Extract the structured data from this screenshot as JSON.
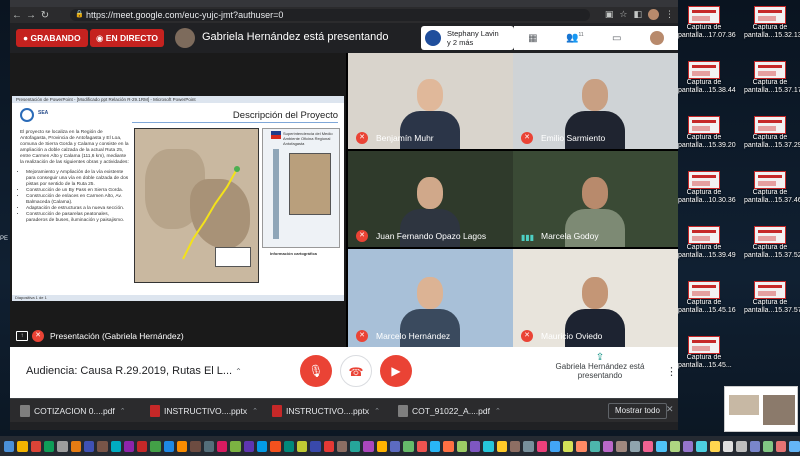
{
  "browser": {
    "url": "https://meet.google.com/euc-yujc-jmt?authuser=0"
  },
  "meet_header": {
    "recording_label": "GRABANDO",
    "live_label": "EN DIRECTO",
    "presenting_title": "Gabriela Hernández está presentando",
    "notif_line1": "Stephany Lavin",
    "notif_line2": "y 2 más",
    "people_count": "11",
    "you_label": "Tú"
  },
  "presentation": {
    "tile_label": "Presentación (Gabriela Hernández)",
    "window_title": "Presentación de PowerPoint - [Modificado ppt Relación R-29.1RM] - Microsoft PowerPoint",
    "slide_heading": "Descripción del Proyecto",
    "slide_logo": "SEA",
    "slide_intro": "El proyecto se localiza en la Región de Antofagasta, Provincia de Antofagasta y El Loa, comuna de Sierra Gorda y Calama y consiste en la ampliación a doble calzada de la actual Ruta 25, entre Carmen Alto y Calama (111,6 km), mediante la realización de las siguientes obras y actividades:",
    "bullets": [
      "Mejoramiento y Ampliación de la vía existente para conseguir una vía en doble calzada de dos pistas por sentido de la Ruta 25.",
      "Construcción de un By Pass en Sierra Gorda.",
      "Construcción de enlaces en Carmen Alto, Av. Balmaceda (Calama).",
      "Adaptación de estructuras a la nueva sección.",
      "Construcción de pasarelas peatonales, paraderos de buses, iluminación y paisajismo."
    ],
    "map_panel_header": "Superintendencia del Medio Ambiente Oficina Regional Antofagasta",
    "info_title": "Información cartográfica",
    "status_bar": "Diapositiva 1 de 1"
  },
  "participants": [
    {
      "name": "Benjamín Muhr",
      "muted": true
    },
    {
      "name": "Emilio Sarmiento",
      "muted": true
    },
    {
      "name": "Juan Fernando Opazo Lagos",
      "muted": true
    },
    {
      "name": "Marcela Godoy",
      "muted": false
    },
    {
      "name": "Marcelo Hernández",
      "muted": true
    },
    {
      "name": "Mauricio Oviedo",
      "muted": true
    }
  ],
  "controls": {
    "meeting_name": "Audiencia: Causa R.29.2019, Rutas El L...",
    "present_status": "Gabriela Hernández está presentando"
  },
  "downloads": [
    {
      "name": "COTIZACION 0....pdf",
      "type": "pdf"
    },
    {
      "name": "INSTRUCTIVO....pptx",
      "type": "pptx"
    },
    {
      "name": "INSTRUCTIVO....pptx",
      "type": "pptx"
    },
    {
      "name": "COT_91022_A....pdf",
      "type": "pdf"
    }
  ],
  "downloads_show_all": "Mostrar todo",
  "desktop_files_col1": [
    {
      "line1": "Captura de",
      "line2": "pantalla...17.07.36"
    },
    {
      "line1": "Captura de",
      "line2": "pantalla...15.38.44"
    },
    {
      "line1": "Captura de",
      "line2": "pantalla...15.39.20"
    },
    {
      "line1": "Captura de",
      "line2": "pantalla...10.30.36"
    },
    {
      "line1": "Captura de",
      "line2": "pantalla...15.39.49"
    },
    {
      "line1": "Captura de",
      "line2": "pantalla...15.45.16"
    },
    {
      "line1": "Captura de",
      "line2": "pantalla...15.45..."
    }
  ],
  "desktop_files_col2": [
    {
      "line1": "Captura de",
      "line2": "pantalla...15.32.13"
    },
    {
      "line1": "Captura de",
      "line2": "pantalla...15.37.17"
    },
    {
      "line1": "Captura de",
      "line2": "pantalla...15.37.29"
    },
    {
      "line1": "Captura de",
      "line2": "pantalla...15.37.46"
    },
    {
      "line1": "Captura de",
      "line2": "pantalla...15.37.52"
    },
    {
      "line1": "Captura de",
      "line2": "pantalla...15.37.57"
    }
  ],
  "desktop_left_text": "PE"
}
